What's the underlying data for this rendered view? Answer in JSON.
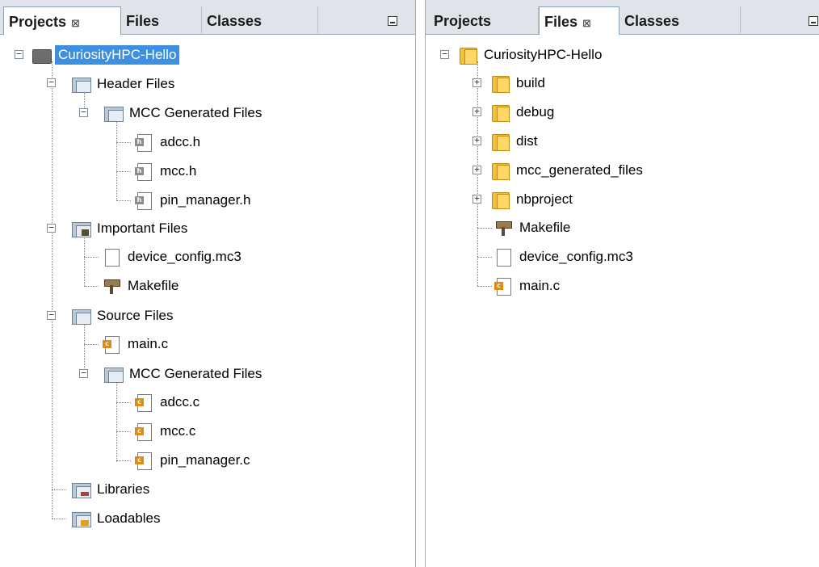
{
  "left_panel": {
    "tabs": [
      {
        "label": "Projects",
        "close": "⊠",
        "active": true
      },
      {
        "label": "Files",
        "close": "",
        "active": false
      },
      {
        "label": "Classes",
        "close": "",
        "active": false
      }
    ],
    "tree": {
      "root": "CuriosityHPC-Hello",
      "header_files": "Header Files",
      "mcc_generated_h": "MCC Generated Files",
      "h_files": [
        "adcc.h",
        "mcc.h",
        "pin_manager.h"
      ],
      "important_files": "Important Files",
      "important_items": [
        "device_config.mc3",
        "Makefile"
      ],
      "source_files": "Source Files",
      "main_c": "main.c",
      "mcc_generated_c": "MCC Generated Files",
      "c_files": [
        "adcc.c",
        "mcc.c",
        "pin_manager.c"
      ],
      "libraries": "Libraries",
      "loadables": "Loadables"
    }
  },
  "right_panel": {
    "tabs": [
      {
        "label": "Projects",
        "close": "",
        "active": false
      },
      {
        "label": "Files",
        "close": "⊠",
        "active": true
      },
      {
        "label": "Classes",
        "close": "",
        "active": false
      }
    ],
    "tree": {
      "root": "CuriosityHPC-Hello",
      "folders": [
        "build",
        "debug",
        "dist",
        "mcc_generated_files",
        "nbproject"
      ],
      "files": [
        "Makefile",
        "device_config.mc3",
        "main.c"
      ]
    }
  },
  "glyphs": {
    "expanded": "−",
    "collapsed": "+"
  },
  "colors": {
    "selection": "#3d8fe0",
    "tab_bar": "#dfe4ea"
  }
}
